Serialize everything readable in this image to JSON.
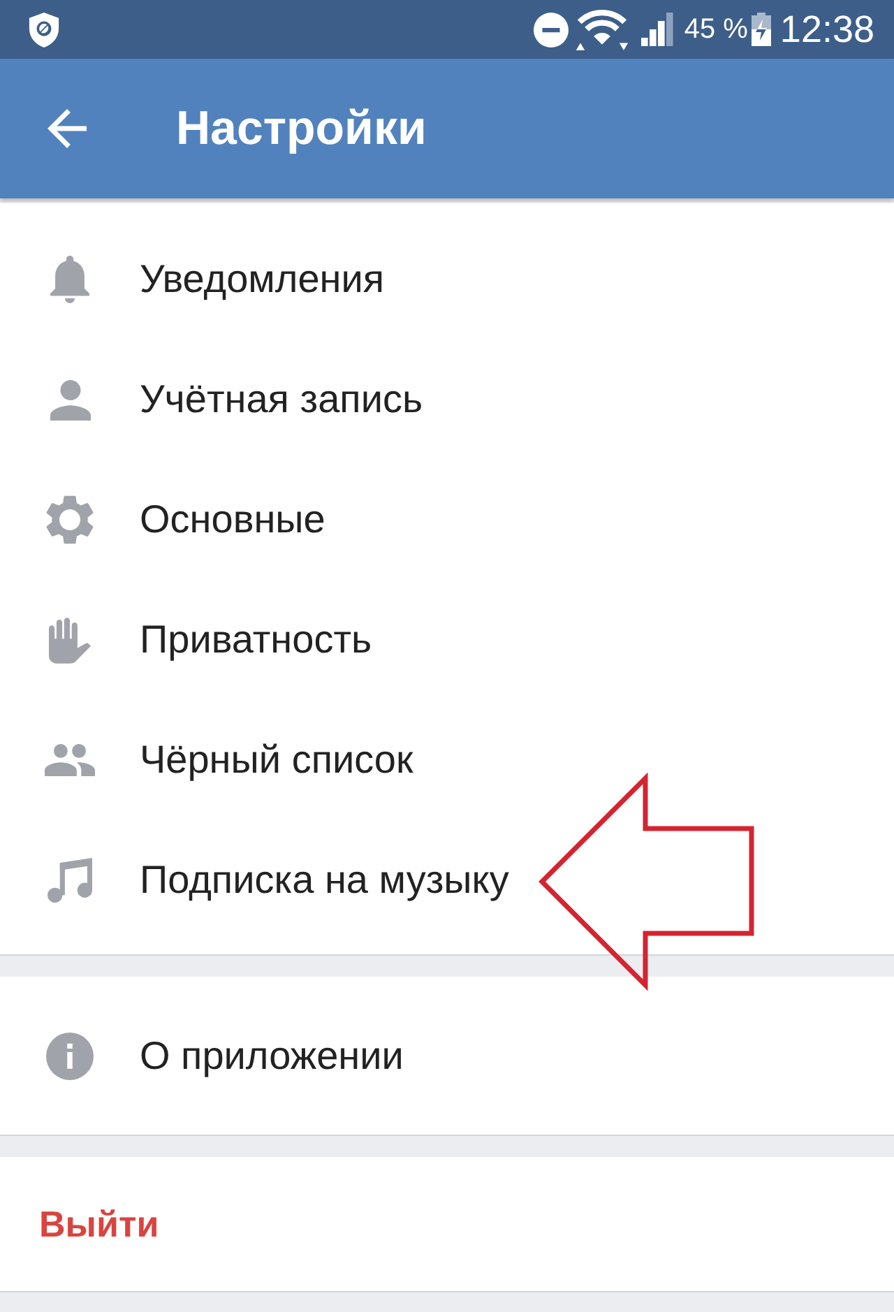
{
  "status_bar": {
    "battery": "45 %",
    "time": "12:38"
  },
  "app_bar": {
    "title": "Настройки"
  },
  "sections": [
    {
      "items": [
        {
          "label": "Уведомления"
        },
        {
          "label": "Учётная запись"
        },
        {
          "label": "Основные"
        },
        {
          "label": "Приватность"
        },
        {
          "label": "Чёрный список"
        },
        {
          "label": "Подписка на музыку"
        }
      ]
    },
    {
      "items": [
        {
          "label": "О приложении"
        }
      ]
    }
  ],
  "logout": {
    "label": "Выйти"
  }
}
